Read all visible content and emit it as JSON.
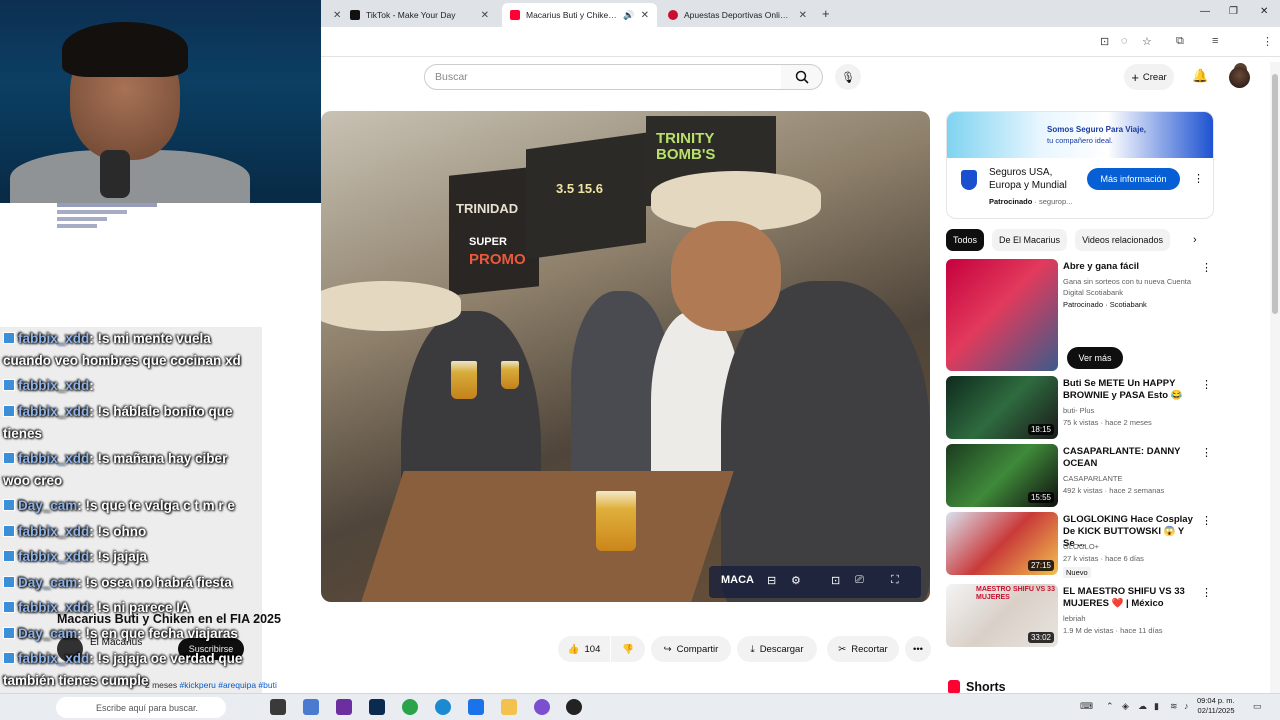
{
  "browser": {
    "tabs": [
      {
        "title": "TikTok - Make Your Day"
      },
      {
        "title": "Macarius Buti y Chiken en el"
      },
      {
        "title": "Apuestas Deportivas Online | Ap"
      }
    ],
    "new_tab": "+"
  },
  "youtube": {
    "search_placeholder": "Buscar",
    "create_label": "Crear"
  },
  "stream_chat": [
    {
      "user": "fabbix_xdd",
      "text": ": !s mi mente vuela"
    },
    {
      "user": "",
      "text": "cuando veo hombres que cocinan xd"
    },
    {
      "user": "fabbix_xdd",
      "text": ":"
    },
    {
      "user": "fabbix_xdd",
      "text": ": !s háblale bonito que"
    },
    {
      "user": "",
      "text": "tienes"
    },
    {
      "user": "fabbix_xdd",
      "text": ": !s mañana hay ciber"
    },
    {
      "user": "",
      "text": "woo creo"
    },
    {
      "user": "Day_cam",
      "text": ": !s que te valga c t m r e"
    },
    {
      "user": "fabbix_xdd",
      "text": ": !s ohno"
    },
    {
      "user": "fabbix_xdd",
      "text": ": !s jajaja"
    },
    {
      "user": "Day_cam",
      "text": ": !s osea no habrá fiesta"
    },
    {
      "user": "fabbix_xdd",
      "text": ": !s ni parece IA"
    },
    {
      "user": "Day_cam",
      "text": ": !s en que fecha viajaras"
    },
    {
      "user": "fabbix_xdd",
      "text": ": !s jajaja oe verdad que"
    },
    {
      "user": "",
      "text": "también tienes cumple"
    },
    {
      "user": "fabbix_xdd",
      "text": ":"
    }
  ],
  "video": {
    "scene_text": {
      "trinidad": "TRINIDAD",
      "super": "SUPER",
      "promo": "PROMO",
      "sign_right": "TRINITY BOMB'S",
      "happy_hour": "3.5 15.6"
    },
    "title": "Macarius Buti y Chiken en el FIA 2025",
    "channel": "El Macarius",
    "subscribe_label": "Suscribirse",
    "likes": "104",
    "actions": {
      "share": "Compartir",
      "download": "Descargar",
      "clip": "Recortar"
    },
    "description_meta": "2 meses",
    "description_tags": "#kickperu #arequipa #buti",
    "control_brand": "MACA"
  },
  "ad": {
    "banner_line1": "Somos Seguro Para Viaje,",
    "banner_line2": "tu compañero ideal.",
    "title": "Seguros USA, Europa y Mundial",
    "sponsored": "Patrocinado",
    "advertiser": "segurop...",
    "cta": "Más información"
  },
  "chips": [
    "Todos",
    "De El Macarius",
    "Videos relacionados"
  ],
  "recommendations": [
    {
      "title": "Abre y gana fácil",
      "meta1": "Gana sin sorteos con tu nueva Cuenta Digital Scotiabank",
      "meta2": "Patrocinado · Scotiabank",
      "cta": "Ver más"
    },
    {
      "title": "Buti Se METE Un HAPPY BROWNIE y PASA Esto 😂",
      "meta1": "buti- Plus",
      "meta2": "75 k vistas · hace 2 meses",
      "duration": "18:15"
    },
    {
      "title": "CASAPARLANTE: DANNY OCEAN",
      "meta1": "CASAPARLANTE",
      "meta2": "492 k vistas · hace 2 semanas",
      "duration": "15:55"
    },
    {
      "title": "GLOGLOKING Hace Cosplay De KICK BUTTOWSKI 😱 Y Se ...",
      "meta1": "GLOGLO+",
      "meta2": "27 k vistas · hace 6 días",
      "badge": "Nuevo",
      "duration": "27:15"
    },
    {
      "title": "EL MAESTRO SHIFU VS 33 MUJERES ❤️ | México",
      "meta1": "lebriah",
      "meta2": "1.9 M de vistas · hace 11 días",
      "duration": "33:02",
      "thumb_text": "MAESTRO SHIFU VS 33 MUJERES"
    }
  ],
  "shorts_label": "Shorts",
  "taskbar": {
    "search_placeholder": "Escribe aquí para buscar.",
    "time": "09:04 p. m.",
    "date": "02/11/2025"
  }
}
